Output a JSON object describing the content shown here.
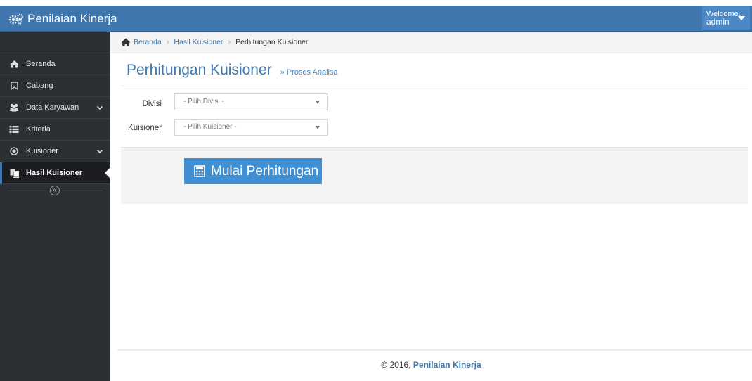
{
  "app": {
    "title": "Penilaian Kinerja"
  },
  "user": {
    "welcome": "Welcome,",
    "name": "admin"
  },
  "sidebar": {
    "items": [
      {
        "label": "Beranda",
        "icon": "home-icon"
      },
      {
        "label": "Cabang",
        "icon": "bookmark-icon"
      },
      {
        "label": "Data Karyawan",
        "icon": "users-icon",
        "expandable": true
      },
      {
        "label": "Kriteria",
        "icon": "list-icon"
      },
      {
        "label": "Kuisioner",
        "icon": "radio-icon",
        "expandable": true
      },
      {
        "label": "Hasil Kuisioner",
        "icon": "copy-icon",
        "active": true
      }
    ],
    "collapse_glyph": "«"
  },
  "breadcrumb": {
    "items": [
      "Beranda",
      "Hasil Kuisioner"
    ],
    "current": "Perhitungan Kuisioner",
    "separator": "›"
  },
  "page": {
    "title": "Perhitungan Kuisioner",
    "subtitle": "» Proses Analisa"
  },
  "form": {
    "divisi_label": "Divisi",
    "divisi_value": "- Pilih Divisi -",
    "kuisioner_label": "Kuisioner",
    "kuisioner_value": "- Pilih Kuisioner -"
  },
  "action": {
    "button_label": "Mulai Perhitungan"
  },
  "footer": {
    "copyright": "© 2016,",
    "brand": "Penilaian Kinerja"
  },
  "colors": {
    "primary": "#3f76ad",
    "button": "#3f8fd2",
    "sidebar": "#2c2f33"
  }
}
